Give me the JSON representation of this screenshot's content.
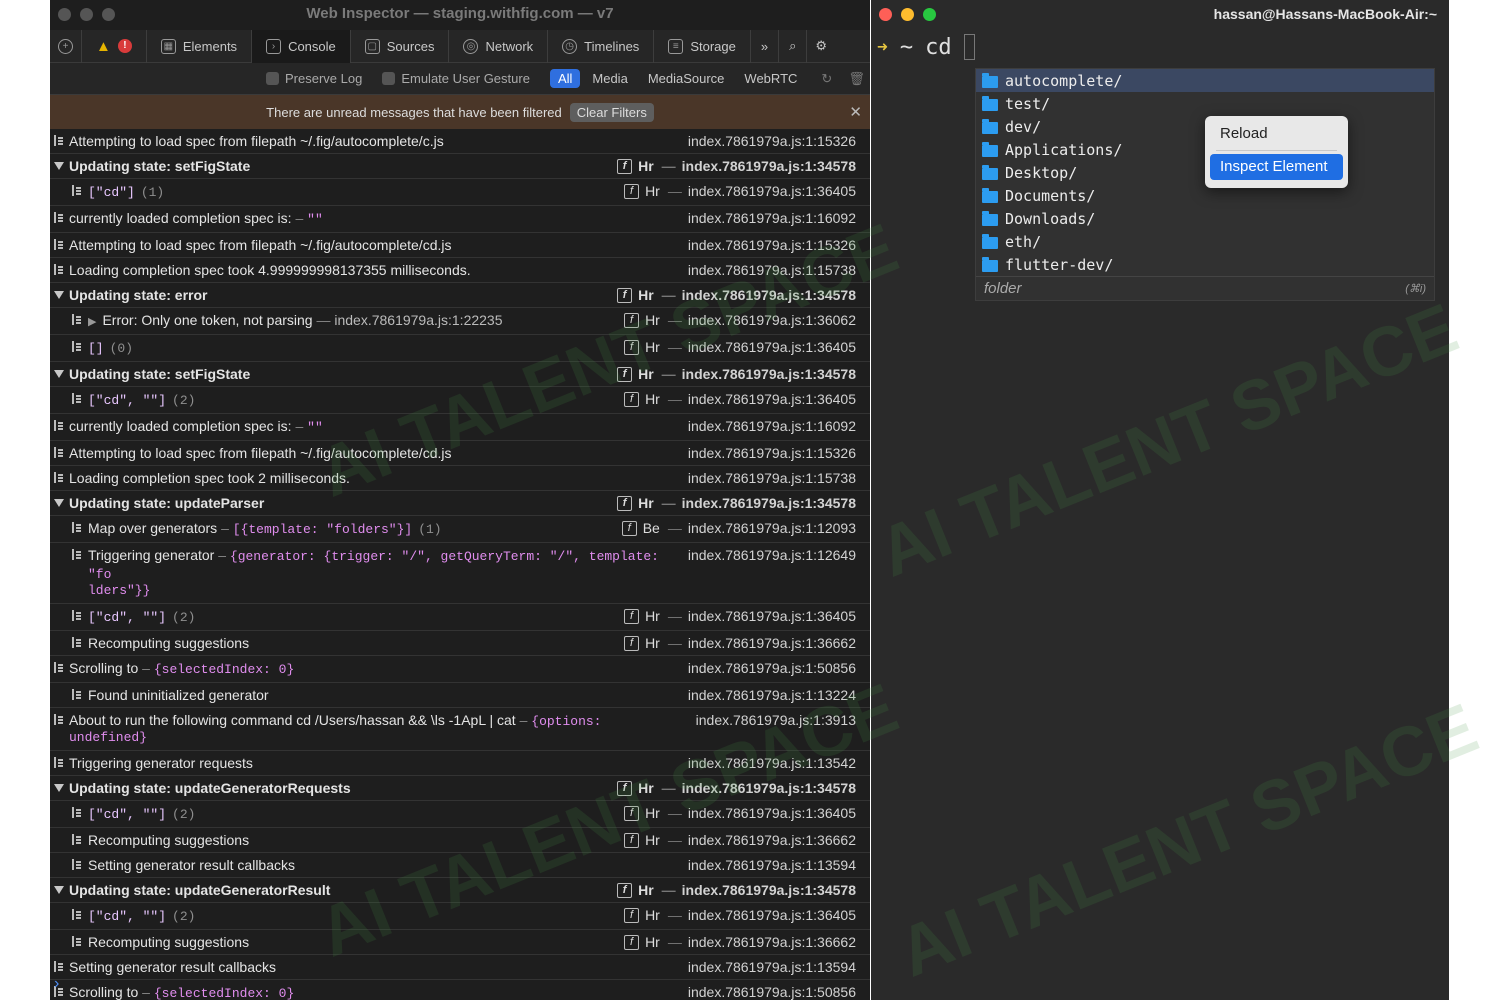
{
  "inspector": {
    "title": "Web Inspector — staging.withfig.com — v7",
    "tabs": [
      {
        "label": "Elements"
      },
      {
        "label": "Console"
      },
      {
        "label": "Sources"
      },
      {
        "label": "Network"
      },
      {
        "label": "Timelines"
      },
      {
        "label": "Storage"
      }
    ],
    "more_tabs": "»",
    "filter": {
      "preserve_log": "Preserve Log",
      "emulate_gesture": "Emulate User Gesture",
      "buttons": [
        "All",
        "Media",
        "MediaSource",
        "WebRTC"
      ],
      "selected": "All"
    },
    "banner": {
      "text": "There are unread messages that have been filtered",
      "clear_filters": "Clear Filters"
    },
    "prompt_glyph": "›"
  },
  "console_rows": [
    {
      "text": "Attempting to load spec from filepath ~/.fig/autocomplete/c.js",
      "src": "index.7861979a.js:1:15326"
    },
    {
      "text": "Updating state: setFigState",
      "src": "index.7861979a.js:1:34578",
      "tag": "Hr"
    },
    {
      "text": "[\"cd\"]",
      "count": "(1)",
      "src": "index.7861979a.js:1:36405",
      "tag": "Hr"
    },
    {
      "text": "currently loaded completion spec is:",
      "sep": " – ",
      "value": "\"\"",
      "src": "index.7861979a.js:1:16092"
    },
    {
      "text": "Attempting to load spec from filepath ~/.fig/autocomplete/cd.js",
      "src": "index.7861979a.js:1:15326"
    },
    {
      "text": "Loading completion spec took 4.999999998137355 milliseconds.",
      "src": "index.7861979a.js:1:15738"
    },
    {
      "text": "Updating state: error",
      "src": "index.7861979a.js:1:34578",
      "tag": "Hr"
    },
    {
      "text": "Error: Only one token, not parsing",
      "sep": " — ",
      "value": "index.7861979a.js:1:22235",
      "src": "index.7861979a.js:1:36062",
      "tag": "Hr"
    },
    {
      "text": "[]",
      "count": "(0)",
      "src": "index.7861979a.js:1:36405",
      "tag": "Hr"
    },
    {
      "text": "Updating state: setFigState",
      "src": "index.7861979a.js:1:34578",
      "tag": "Hr"
    },
    {
      "text": "[\"cd\", \"\"]",
      "count": "(2)",
      "src": "index.7861979a.js:1:36405",
      "tag": "Hr"
    },
    {
      "text": "currently loaded completion spec is:",
      "sep": " – ",
      "value": "\"\"",
      "src": "index.7861979a.js:1:16092"
    },
    {
      "text": "Attempting to load spec from filepath ~/.fig/autocomplete/cd.js",
      "src": "index.7861979a.js:1:15326"
    },
    {
      "text": "Loading completion spec took 2 milliseconds.",
      "src": "index.7861979a.js:1:15738"
    },
    {
      "text": "Updating state: updateParser",
      "src": "index.7861979a.js:1:34578",
      "tag": "Hr"
    },
    {
      "text": "Map over generators",
      "sep": " – ",
      "value": "[{template: \"folders\"}]",
      "count": "(1)",
      "src": "index.7861979a.js:1:12093",
      "tag": "Be"
    },
    {
      "text": "Triggering generator",
      "sep": " – ",
      "value": "{generator: {trigger: \"/\", getQueryTerm: \"/\", template: \"fo",
      "value2": "lders\"}}",
      "src": "index.7861979a.js:1:12649"
    },
    {
      "text": "[\"cd\", \"\"]",
      "count": "(2)",
      "src": "index.7861979a.js:1:36405",
      "tag": "Hr"
    },
    {
      "text": "Recomputing suggestions",
      "src": "index.7861979a.js:1:36662",
      "tag": "Hr"
    },
    {
      "text": "Scrolling to",
      "sep": " – ",
      "value": "{selectedIndex: 0}",
      "src": "index.7861979a.js:1:50856"
    },
    {
      "text": "Found uninitialized generator",
      "src": "index.7861979a.js:1:13224"
    },
    {
      "text": "About to run the following command cd /Users/hassan && \\ls -1ApL | cat",
      "sep": " – ",
      "value": "{options:",
      "value2": "undefined}",
      "src": "index.7861979a.js:1:3913"
    },
    {
      "text": "Triggering generator requests",
      "src": "index.7861979a.js:1:13542"
    },
    {
      "text": "Updating state: updateGeneratorRequests",
      "src": "index.7861979a.js:1:34578",
      "tag": "Hr"
    },
    {
      "text": "[\"cd\", \"\"]",
      "count": "(2)",
      "src": "index.7861979a.js:1:36405",
      "tag": "Hr"
    },
    {
      "text": "Recomputing suggestions",
      "src": "index.7861979a.js:1:36662",
      "tag": "Hr"
    },
    {
      "text": "Setting generator result callbacks",
      "src": "index.7861979a.js:1:13594"
    },
    {
      "text": "Updating state: updateGeneratorResult",
      "src": "index.7861979a.js:1:34578",
      "tag": "Hr"
    },
    {
      "text": "[\"cd\", \"\"]",
      "count": "(2)",
      "src": "index.7861979a.js:1:36405",
      "tag": "Hr"
    },
    {
      "text": "Recomputing suggestions",
      "src": "index.7861979a.js:1:36662",
      "tag": "Hr"
    },
    {
      "text": "Setting generator result callbacks",
      "src": "index.7861979a.js:1:13594"
    },
    {
      "text": "Scrolling to",
      "sep": " – ",
      "value": "{selectedIndex: 0}",
      "src": "index.7861979a.js:1:50856"
    }
  ],
  "terminal": {
    "title": "hassan@Hassans-MacBook-Air:~",
    "arrow": "➜",
    "cwd": "~",
    "command": "cd",
    "suggestions": [
      "autocomplete/",
      "test/",
      "dev/",
      "Applications/",
      "Desktop/",
      "Documents/",
      "Downloads/",
      "eth/",
      "flutter-dev/"
    ],
    "selected_suggestion": "autocomplete/",
    "footer_label": "folder",
    "footer_shortcut": "(⌘i)"
  },
  "context_menu": {
    "items": [
      "Reload",
      "Inspect Element"
    ],
    "selected": "Inspect Element"
  },
  "watermark": "AI TALENT SPACE",
  "colors": {
    "traffic_red": "#fe5f57",
    "traffic_yellow": "#febc2e",
    "traffic_green": "#28c840",
    "accent_blue": "#2f6fdf",
    "folder_blue": "#2c9cf0"
  }
}
